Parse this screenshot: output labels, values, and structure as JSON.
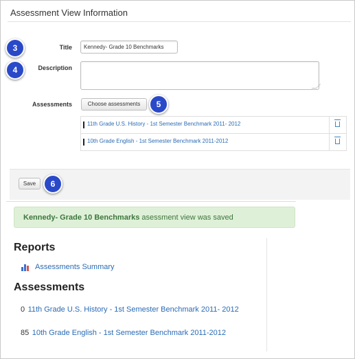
{
  "header": {
    "title": "Assessment View Information"
  },
  "form": {
    "title_label": "Title",
    "title_value": "Kennedy- Grade 10 Benchmarks",
    "description_label": "Description",
    "description_value": "",
    "assessments_label": "Assessments",
    "choose_button": "Choose assessments",
    "rows": [
      {
        "name": "11th Grade U.S. History - 1st Semester Benchmark 2011- 2012"
      },
      {
        "name": "10th Grade English - 1st Semester Benchmark 2011-2012"
      }
    ],
    "save_button": "Save"
  },
  "badges": [
    "3",
    "4",
    "5",
    "6"
  ],
  "alert": {
    "bold": "Kennedy- Grade 10 Benchmarks",
    "text": " asessment view was saved"
  },
  "reports": {
    "heading": "Reports",
    "items": [
      {
        "label": "Assessments Summary",
        "icon": "bar-chart-icon"
      }
    ]
  },
  "assessments": {
    "heading": "Assessments",
    "items": [
      {
        "count": "0",
        "label": "11th Grade U.S. History - 1st Semester Benchmark 2011- 2012"
      },
      {
        "count": "85",
        "label": "10th Grade English - 1st Semester Benchmark 2011-2012"
      }
    ]
  },
  "colors": {
    "link": "#2a6bb5",
    "badge": "#2a49c9",
    "alert_bg": "#dff0d8",
    "alert_text": "#3c763d"
  }
}
